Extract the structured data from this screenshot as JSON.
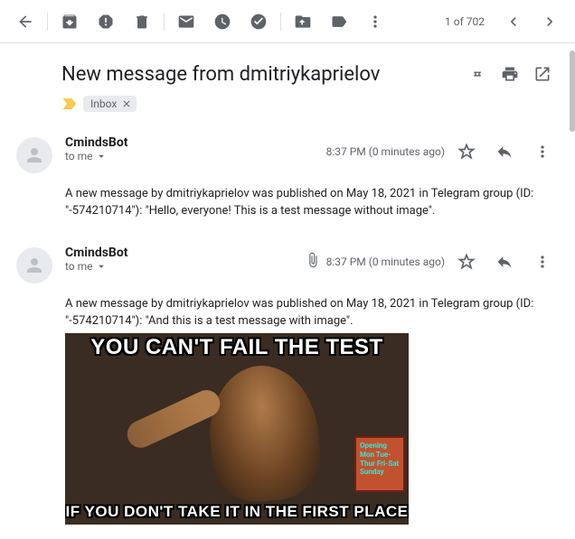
{
  "toolbar": {
    "page_indicator": "1 of 702"
  },
  "subject": "New message from dmitriykaprielov",
  "label_chip": "Inbox",
  "messages": [
    {
      "sender": "CmindsBot",
      "to_line": "to me",
      "time": "8:37 PM (0 minutes ago)",
      "has_attachment": false,
      "body": "A new message by dmitriykaprielov was published on May 18, 2021 in Telegram group (ID: \"-574210714\"): \"Hello, everyone! This is a test message without image\"."
    },
    {
      "sender": "CmindsBot",
      "to_line": "to me",
      "time": "8:37 PM (0 minutes ago)",
      "has_attachment": true,
      "body": "A new message by dmitriykaprielov was published on May 18, 2021 in Telegram group (ID: \"-574210714\"): \"And this is a test message with image\"."
    }
  ],
  "meme": {
    "top": "YOU CAN'T FAIL THE TEST",
    "bottom": "IF YOU DON'T TAKE IT IN THE FIRST PLACE",
    "sign": "Opening\nMon\nTue-Thur\nFri-Sat\nSunday"
  }
}
